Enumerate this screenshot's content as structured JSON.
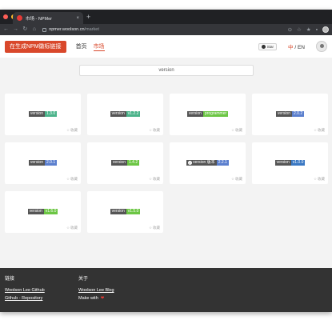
{
  "browser": {
    "tab_title": "市场 - NPMer",
    "tab_close": "×",
    "new_tab": "+",
    "url_host": "npmer.woolson.cn",
    "url_path": "/market",
    "traffic_colors": [
      "#ff5f57",
      "#febc2e",
      "#28c840"
    ]
  },
  "header": {
    "cta_label": "在生成NPM徽标链接",
    "nav": [
      {
        "label": "首页",
        "active": false
      },
      {
        "label": "市场",
        "active": true
      }
    ],
    "star_label": "Star",
    "lang_zh": "中",
    "lang_sep": " / ",
    "lang_en": "EN",
    "accent": "#d9482b"
  },
  "search": {
    "value": "version"
  },
  "cards": [
    {
      "left": "version",
      "right": "1.3.0",
      "color": "#4bb38a",
      "collect": "收藏"
    },
    {
      "left": "version",
      "right": "v1.2.2",
      "color": "#4bb38a",
      "collect": "收藏"
    },
    {
      "left": "version",
      "right": "programmer",
      "color": "#6cc644",
      "collect": "收藏"
    },
    {
      "left": "version",
      "right": "2.0.2",
      "color": "#5b7fce",
      "collect": "收藏"
    },
    {
      "left": "version",
      "right": "2.0.1",
      "color": "#5b7fce",
      "collect": "收藏"
    },
    {
      "left": "version",
      "right": "1.4.2",
      "color": "#6cc644",
      "collect": "收藏"
    },
    {
      "left": "version 版本",
      "right": "2.2.1",
      "color": "#5b7fce",
      "collect": "收藏",
      "check": true
    },
    {
      "left": "version",
      "right": "v1.0.0",
      "color": "#3a78c3",
      "collect": "收藏"
    },
    {
      "left": "version",
      "right": "v1.6.0",
      "color": "#6cc644",
      "collect": "收藏"
    },
    {
      "left": "version",
      "right": "v1.5.0",
      "color": "#6cc644",
      "collect": "收藏"
    }
  ],
  "footer": {
    "links_title": "链接",
    "links": [
      "Woolson Lee Github",
      "Github - Repository"
    ],
    "about_title": "关于",
    "about_link": "Woolson Lee Blog",
    "made_with": "Make with",
    "heart": "❤"
  }
}
